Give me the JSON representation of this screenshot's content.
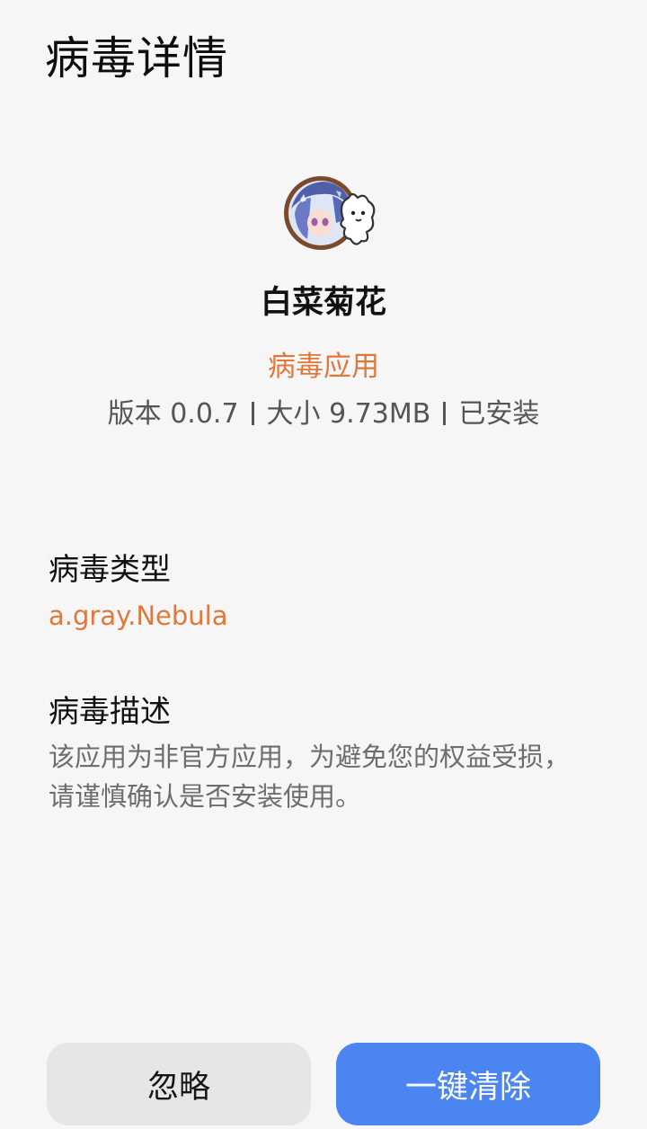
{
  "page": {
    "title": "病毒详情"
  },
  "app": {
    "icon": "app-avatar-icon",
    "name": "白菜菊花",
    "status_badge": "病毒应用",
    "version": "版本 0.0.7",
    "size": "大小 9.73MB",
    "install_state": "已安装"
  },
  "virus_type": {
    "label": "病毒类型",
    "value": "a.gray.Nebula"
  },
  "virus_description": {
    "label": "病毒描述",
    "text": "该应用为非官方应用，为避免您的权益受损，请谨慎确认是否安装使用。"
  },
  "actions": {
    "ignore_label": "忽略",
    "clean_label": "一键清除"
  },
  "colors": {
    "background": "#f6f6f6",
    "warning_accent": "#e0783c",
    "primary_button": "#4b85f2",
    "secondary_button": "#e6e6e6"
  }
}
